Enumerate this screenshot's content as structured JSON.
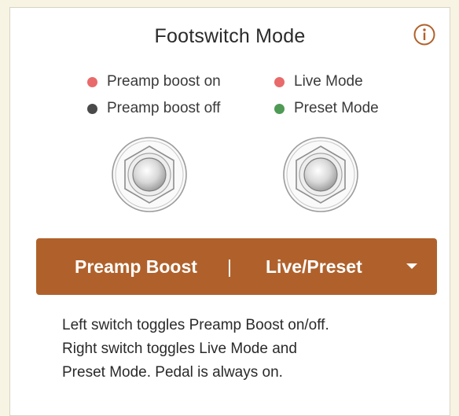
{
  "title": "Footswitch Mode",
  "info_icon": "info-circle-icon",
  "legend": {
    "left": [
      {
        "label": "Preamp boost on",
        "color": "#e96a6a"
      },
      {
        "label": "Preamp boost off",
        "color": "#4a4a4a"
      }
    ],
    "right": [
      {
        "label": "Live Mode",
        "color": "#e96a6a"
      },
      {
        "label": "Preset Mode",
        "color": "#4f9a55"
      }
    ]
  },
  "mode_selector": {
    "left_option": "Preamp Boost",
    "separator": "|",
    "right_option": "Live/Preset",
    "icon": "chevron-down-icon"
  },
  "description": [
    "Left switch toggles Preamp Boost on/off.",
    "Right switch toggles Live Mode and",
    "Preset Mode. Pedal is always on."
  ],
  "colors": {
    "accent": "#b0612b",
    "background": "#f8f4e4",
    "panel": "#ffffff"
  }
}
